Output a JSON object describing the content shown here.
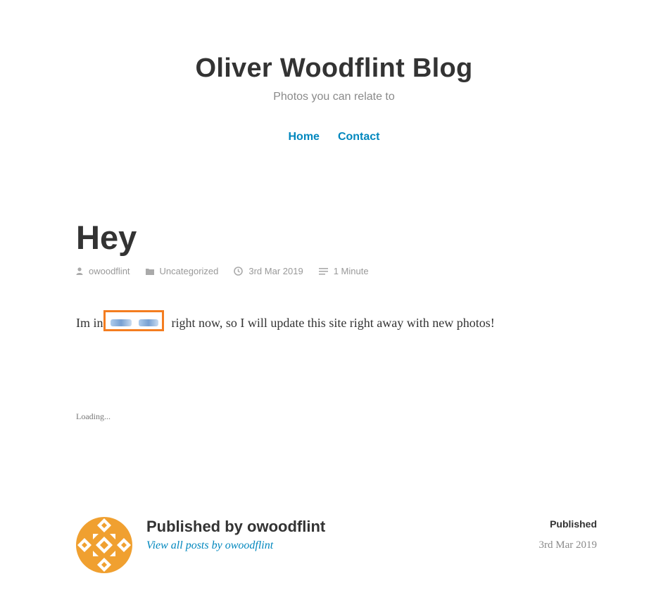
{
  "site": {
    "title": "Oliver Woodflint Blog",
    "description": "Photos you can relate to"
  },
  "nav": {
    "items": [
      "Home",
      "Contact"
    ]
  },
  "post": {
    "title": "Hey",
    "meta": {
      "author": "owoodflint",
      "category": "Uncategorized",
      "date": "3rd Mar 2019",
      "reading_time": "1 Minute"
    },
    "content_before": "Im in ",
    "content_after": " right now, so I will update this site right away with new photos!",
    "loading": "Loading..."
  },
  "author_box": {
    "title": "Published by owoodflint",
    "link": "View all posts by owoodflint",
    "published_label": "Published",
    "published_date": "3rd Mar 2019"
  },
  "colors": {
    "link": "#0087be",
    "highlight_box": "#f47d20",
    "avatar": "#f0a030"
  }
}
